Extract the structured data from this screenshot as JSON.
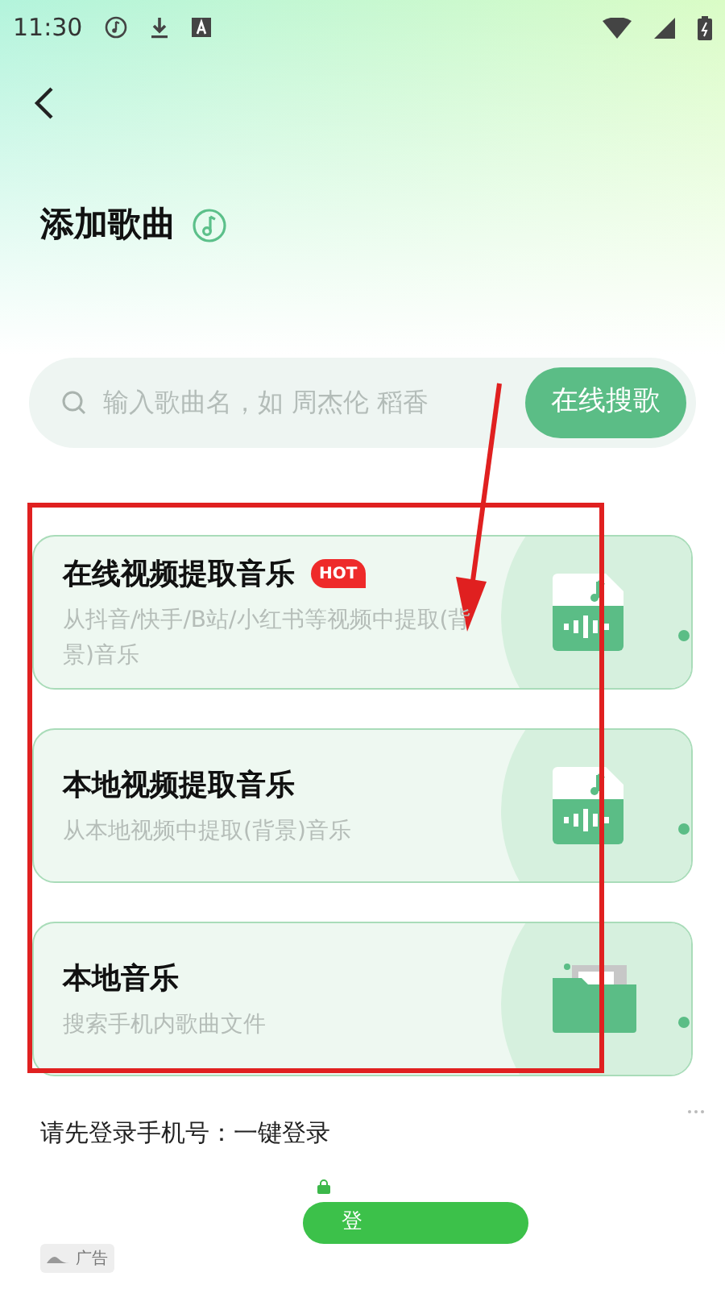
{
  "status_bar": {
    "time": "11:30"
  },
  "page": {
    "title": "添加歌曲"
  },
  "search": {
    "placeholder": "输入歌曲名，如 周杰伦 稻香",
    "button": "在线搜歌"
  },
  "options": [
    {
      "title": "在线视频提取音乐",
      "badge": "HOT",
      "subtitle": "从抖音/快手/B站/小红书等视频中提取(背景)音乐",
      "kind": "audio_file"
    },
    {
      "title": "本地视频提取音乐",
      "subtitle": "从本地视频中提取(背景)音乐",
      "kind": "audio_file"
    },
    {
      "title": "本地音乐",
      "subtitle": "搜索手机内歌曲文件",
      "kind": "folder"
    }
  ],
  "ad": {
    "text": "请先登录手机号：一键登录",
    "button": "登",
    "label": "广告"
  }
}
